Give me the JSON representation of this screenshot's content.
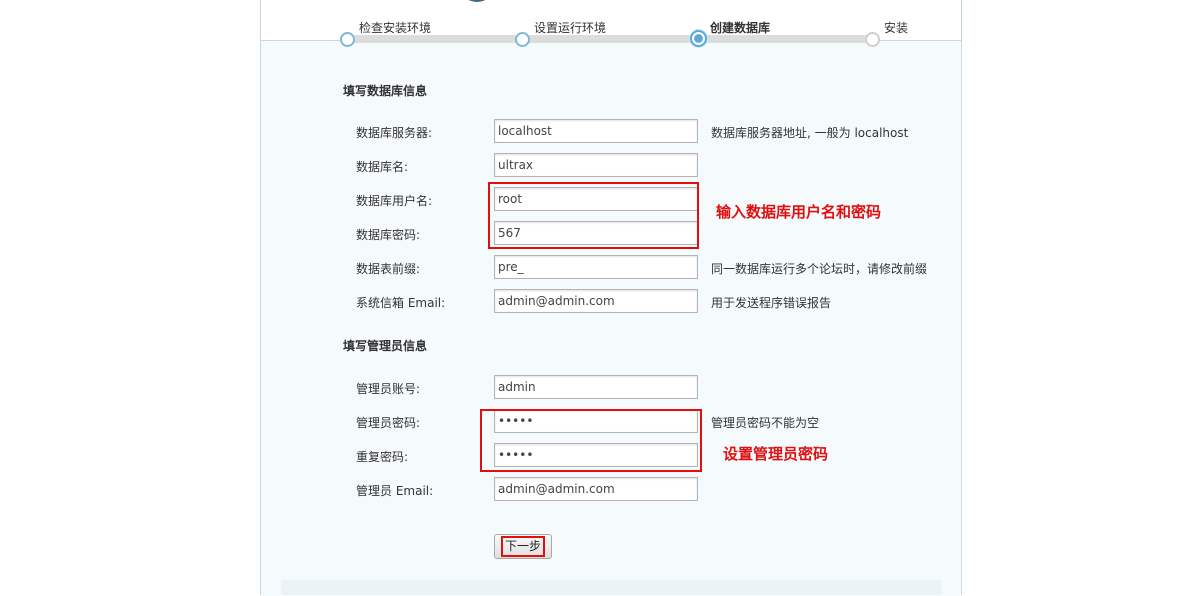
{
  "steps": [
    {
      "label": "检查安装环境",
      "state": "done"
    },
    {
      "label": "设置运行环境",
      "state": "done"
    },
    {
      "label": "创建数据库",
      "state": "active"
    },
    {
      "label": "安装",
      "state": "todo"
    }
  ],
  "db_section": {
    "title": "填写数据库信息",
    "rows": [
      {
        "label": "数据库服务器:",
        "value": "localhost",
        "hint": "数据库服务器地址, 一般为 localhost"
      },
      {
        "label": "数据库名:",
        "value": "ultrax",
        "hint": ""
      },
      {
        "label": "数据库用户名:",
        "value": "root",
        "hint": ""
      },
      {
        "label": "数据库密码:",
        "value": "567",
        "hint": ""
      },
      {
        "label": "数据表前缀:",
        "value": "pre_",
        "hint": "同一数据库运行多个论坛时，请修改前缀"
      },
      {
        "label": "系统信箱 Email:",
        "value": "admin@admin.com",
        "hint": "用于发送程序错误报告"
      }
    ],
    "annotation": "输入数据库用户名和密码"
  },
  "admin_section": {
    "title": "填写管理员信息",
    "rows": [
      {
        "label": "管理员账号:",
        "value": "admin",
        "hint": ""
      },
      {
        "label": "管理员密码:",
        "value": "•••••",
        "hint": "管理员密码不能为空"
      },
      {
        "label": "重复密码:",
        "value": "•••••",
        "hint": ""
      },
      {
        "label": "管理员 Email:",
        "value": "admin@admin.com",
        "hint": ""
      }
    ],
    "annotation": "设置管理员密码"
  },
  "next_button": {
    "label": "下一步"
  },
  "colors": {
    "annotation_red": "#e01010",
    "step_blue": "#5aa9d6",
    "panel_bg": "#f5fafd"
  }
}
